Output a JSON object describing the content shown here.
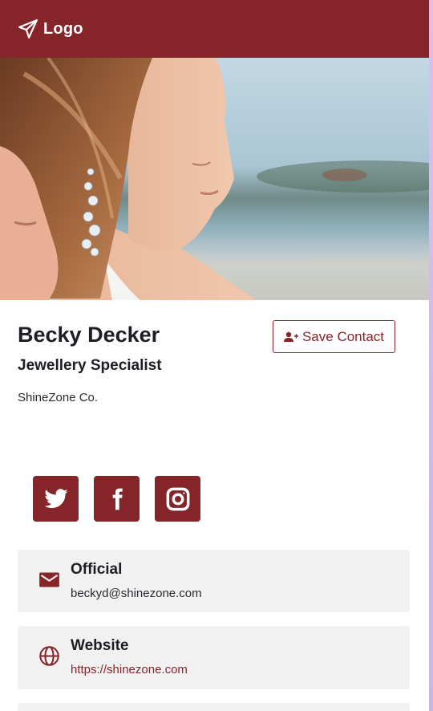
{
  "header": {
    "logo_text": "Logo",
    "logo_icon": "paper-plane-icon"
  },
  "hero": {
    "image": "woman-with-earring-photo"
  },
  "profile": {
    "name": "Becky Decker",
    "title": "Jewellery Specialist",
    "company": "ShineZone Co.",
    "save_button": "Save Contact",
    "save_icon": "user-plus-icon"
  },
  "socials": [
    {
      "name": "twitter",
      "icon": "twitter-icon"
    },
    {
      "name": "facebook",
      "icon": "facebook-icon"
    },
    {
      "name": "instagram",
      "icon": "instagram-icon"
    }
  ],
  "contacts": [
    {
      "label": "Official",
      "value": "beckyd@shinezone.com",
      "icon": "mail-icon"
    },
    {
      "label": "Website",
      "value": "https://shinezone.com",
      "icon": "globe-icon"
    }
  ],
  "colors": {
    "brand": "#85252a",
    "card_bg": "#f1f1f1",
    "side_bg": "#d6bcec"
  }
}
